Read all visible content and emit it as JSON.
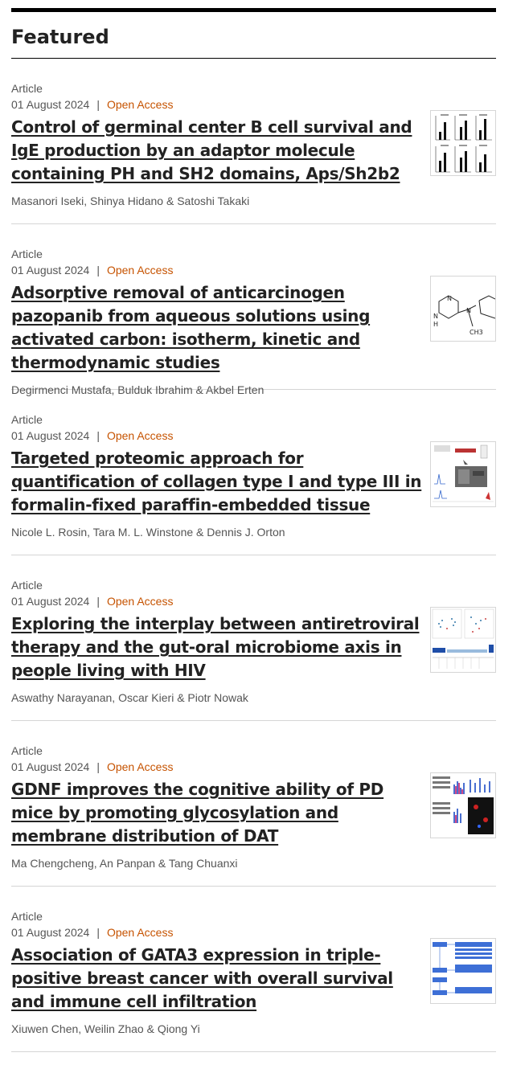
{
  "section": {
    "title": "Featured"
  },
  "articles": [
    {
      "type": "Article",
      "date": "01 August 2024",
      "separator": "|",
      "access": "Open Access",
      "title": "Control of germinal center B cell survival and IgE production by an adaptor molecule containing PH and SH2 domains, Aps/Sh2b2",
      "authors": "Masanori Iseki, Shinya Hidano & Satoshi Takaki",
      "thumbnail": "bar-chart-figure-thumbnail"
    },
    {
      "type": "Article",
      "date": "01 August 2024",
      "separator": "|",
      "access": "Open Access",
      "title": "Adsorptive removal of anticarcinogen pazopanib from aqueous solutions using activated carbon: isotherm, kinetic and thermodynamic studies",
      "authors": "Degirmenci Mustafa, Bulduk Ibrahim & Akbel Erten",
      "thumbnail": "chemical-structure-thumbnail",
      "thumb_labels": [
        "N",
        "N",
        "H",
        "N",
        "CH3"
      ]
    },
    {
      "type": "Article",
      "date": "01 August 2024",
      "separator": "|",
      "access": "Open Access",
      "title": "Targeted proteomic approach for quantification of collagen type I and type III in formalin-fixed paraffin-embedded tissue",
      "authors": "Nicole L. Rosin, Tara M. L. Winstone & Dennis J. Orton",
      "thumbnail": "proteomics-workflow-thumbnail"
    },
    {
      "type": "Article",
      "date": "01 August 2024",
      "separator": "|",
      "access": "Open Access",
      "title": "Exploring the interplay between antiretroviral therapy and the gut-oral microbiome axis in people living with HIV",
      "authors": "Aswathy Narayanan, Oscar Kieri & Piotr Nowak",
      "thumbnail": "microbiome-plot-thumbnail"
    },
    {
      "type": "Article",
      "date": "01 August 2024",
      "separator": "|",
      "access": "Open Access",
      "title": "GDNF improves the cognitive ability of PD mice by promoting glycosylation and membrane distribution of DAT",
      "authors": "Ma Chengcheng, An Panpan & Tang Chuanxi",
      "thumbnail": "western-blot-panel-thumbnail"
    },
    {
      "type": "Article",
      "date": "01 August 2024",
      "separator": "|",
      "access": "Open Access",
      "title": "Association of GATA3 expression in triple-positive breast cancer with overall survival and immune cell infiltration",
      "authors": "Xiuwen Chen, Weilin Zhao & Qiong Yi",
      "thumbnail": "flowchart-thumbnail"
    }
  ],
  "colors": {
    "open_access": "#c65301",
    "text": "#222222",
    "muted": "#555555",
    "rule": "#000000"
  }
}
